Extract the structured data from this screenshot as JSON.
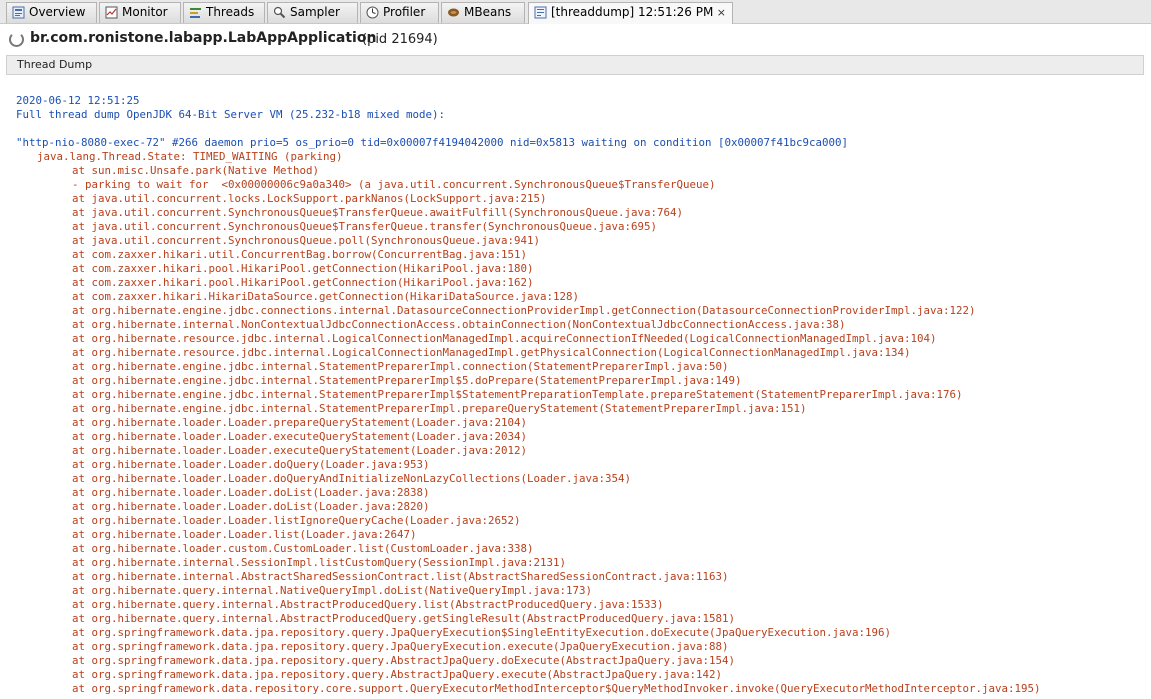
{
  "tabs": [
    {
      "label": "Overview",
      "icon": "overview-icon"
    },
    {
      "label": "Monitor",
      "icon": "monitor-icon"
    },
    {
      "label": "Threads",
      "icon": "threads-icon"
    },
    {
      "label": "Sampler",
      "icon": "sampler-icon"
    },
    {
      "label": "Profiler",
      "icon": "profiler-icon"
    },
    {
      "label": "MBeans",
      "icon": "mbeans-icon"
    },
    {
      "label": "[threaddump] 12:51:26 PM",
      "icon": "threaddump-icon",
      "close": "×",
      "active": true
    }
  ],
  "header": {
    "app": "br.com.ronistone.labapp.LabAppApplication",
    "pid": "(pid 21694)"
  },
  "section": {
    "label": "Thread Dump"
  },
  "colors": {
    "header_text": "#1b4fb3",
    "stack_text": "#b8401c"
  },
  "dump": {
    "timestamp": "2020-06-12 12:51:25",
    "vm_line": "Full thread dump OpenJDK 64-Bit Server VM (25.232-b18 mixed mode):",
    "thread_header": "\"http-nio-8080-exec-72\" #266 daemon prio=5 os_prio=0 tid=0x00007f4194042000 nid=0x5813 waiting on condition [0x00007f41bc9ca000]",
    "thread_state": "java.lang.Thread.State: TIMED_WAITING (parking)",
    "frames": [
      "at sun.misc.Unsafe.park(Native Method)",
      "- parking to wait for  <0x00000006c9a0a340> (a java.util.concurrent.SynchronousQueue$TransferQueue)",
      "at java.util.concurrent.locks.LockSupport.parkNanos(LockSupport.java:215)",
      "at java.util.concurrent.SynchronousQueue$TransferQueue.awaitFulfill(SynchronousQueue.java:764)",
      "at java.util.concurrent.SynchronousQueue$TransferQueue.transfer(SynchronousQueue.java:695)",
      "at java.util.concurrent.SynchronousQueue.poll(SynchronousQueue.java:941)",
      "at com.zaxxer.hikari.util.ConcurrentBag.borrow(ConcurrentBag.java:151)",
      "at com.zaxxer.hikari.pool.HikariPool.getConnection(HikariPool.java:180)",
      "at com.zaxxer.hikari.pool.HikariPool.getConnection(HikariPool.java:162)",
      "at com.zaxxer.hikari.HikariDataSource.getConnection(HikariDataSource.java:128)",
      "at org.hibernate.engine.jdbc.connections.internal.DatasourceConnectionProviderImpl.getConnection(DatasourceConnectionProviderImpl.java:122)",
      "at org.hibernate.internal.NonContextualJdbcConnectionAccess.obtainConnection(NonContextualJdbcConnectionAccess.java:38)",
      "at org.hibernate.resource.jdbc.internal.LogicalConnectionManagedImpl.acquireConnectionIfNeeded(LogicalConnectionManagedImpl.java:104)",
      "at org.hibernate.resource.jdbc.internal.LogicalConnectionManagedImpl.getPhysicalConnection(LogicalConnectionManagedImpl.java:134)",
      "at org.hibernate.engine.jdbc.internal.StatementPreparerImpl.connection(StatementPreparerImpl.java:50)",
      "at org.hibernate.engine.jdbc.internal.StatementPreparerImpl$5.doPrepare(StatementPreparerImpl.java:149)",
      "at org.hibernate.engine.jdbc.internal.StatementPreparerImpl$StatementPreparationTemplate.prepareStatement(StatementPreparerImpl.java:176)",
      "at org.hibernate.engine.jdbc.internal.StatementPreparerImpl.prepareQueryStatement(StatementPreparerImpl.java:151)",
      "at org.hibernate.loader.Loader.prepareQueryStatement(Loader.java:2104)",
      "at org.hibernate.loader.Loader.executeQueryStatement(Loader.java:2034)",
      "at org.hibernate.loader.Loader.executeQueryStatement(Loader.java:2012)",
      "at org.hibernate.loader.Loader.doQuery(Loader.java:953)",
      "at org.hibernate.loader.Loader.doQueryAndInitializeNonLazyCollections(Loader.java:354)",
      "at org.hibernate.loader.Loader.doList(Loader.java:2838)",
      "at org.hibernate.loader.Loader.doList(Loader.java:2820)",
      "at org.hibernate.loader.Loader.listIgnoreQueryCache(Loader.java:2652)",
      "at org.hibernate.loader.Loader.list(Loader.java:2647)",
      "at org.hibernate.loader.custom.CustomLoader.list(CustomLoader.java:338)",
      "at org.hibernate.internal.SessionImpl.listCustomQuery(SessionImpl.java:2131)",
      "at org.hibernate.internal.AbstractSharedSessionContract.list(AbstractSharedSessionContract.java:1163)",
      "at org.hibernate.query.internal.NativeQueryImpl.doList(NativeQueryImpl.java:173)",
      "at org.hibernate.query.internal.AbstractProducedQuery.list(AbstractProducedQuery.java:1533)",
      "at org.hibernate.query.internal.AbstractProducedQuery.getSingleResult(AbstractProducedQuery.java:1581)",
      "at org.springframework.data.jpa.repository.query.JpaQueryExecution$SingleEntityExecution.doExecute(JpaQueryExecution.java:196)",
      "at org.springframework.data.jpa.repository.query.JpaQueryExecution.execute(JpaQueryExecution.java:88)",
      "at org.springframework.data.jpa.repository.query.AbstractJpaQuery.doExecute(AbstractJpaQuery.java:154)",
      "at org.springframework.data.jpa.repository.query.AbstractJpaQuery.execute(AbstractJpaQuery.java:142)",
      "at org.springframework.data.repository.core.support.QueryExecutorMethodInterceptor$QueryMethodInvoker.invoke(QueryExecutorMethodInterceptor.java:195)"
    ]
  }
}
